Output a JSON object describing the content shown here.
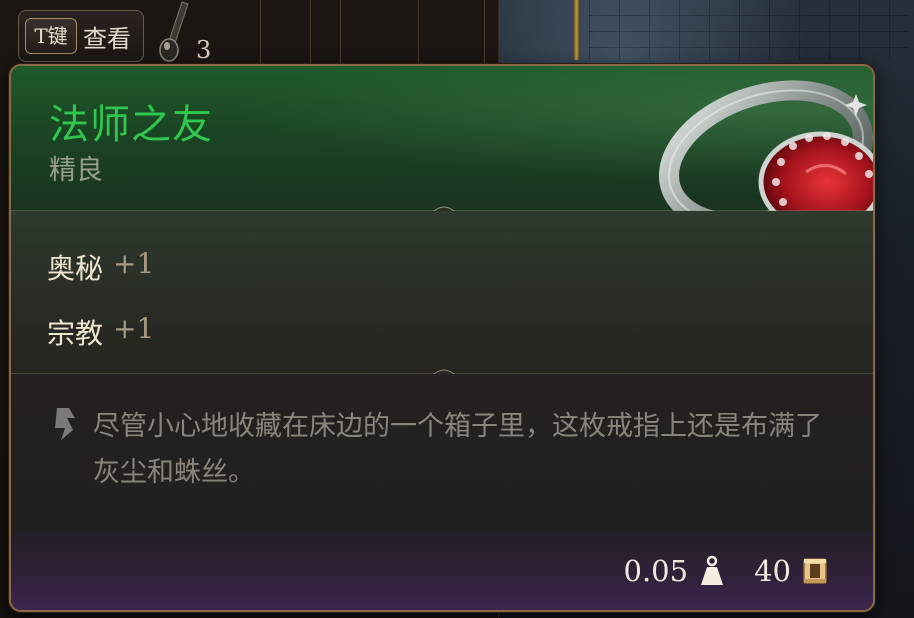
{
  "hotkey": {
    "key_label": "T键",
    "action_label": "查看"
  },
  "inventory": {
    "stack_count": "3"
  },
  "tooltip": {
    "item_name": "法师之友",
    "rarity": "精良",
    "stats": [
      {
        "name": "奥秘",
        "bonus": "+1"
      },
      {
        "name": "宗教",
        "bonus": "+1"
      }
    ],
    "description": "尽管小心地收藏在床边的一个箱子里，这枚戒指上还是布满了灰尘和蛛丝。",
    "weight": "0.05",
    "value": "40",
    "icons": {
      "ring": "ring-icon",
      "quote": "quote-mark-icon",
      "weight": "weight-icon",
      "gold": "gold-coin-icon"
    },
    "colors": {
      "name": "#2fc74d",
      "rarity": "#9a9f8a",
      "border": "#8a6a45"
    }
  }
}
